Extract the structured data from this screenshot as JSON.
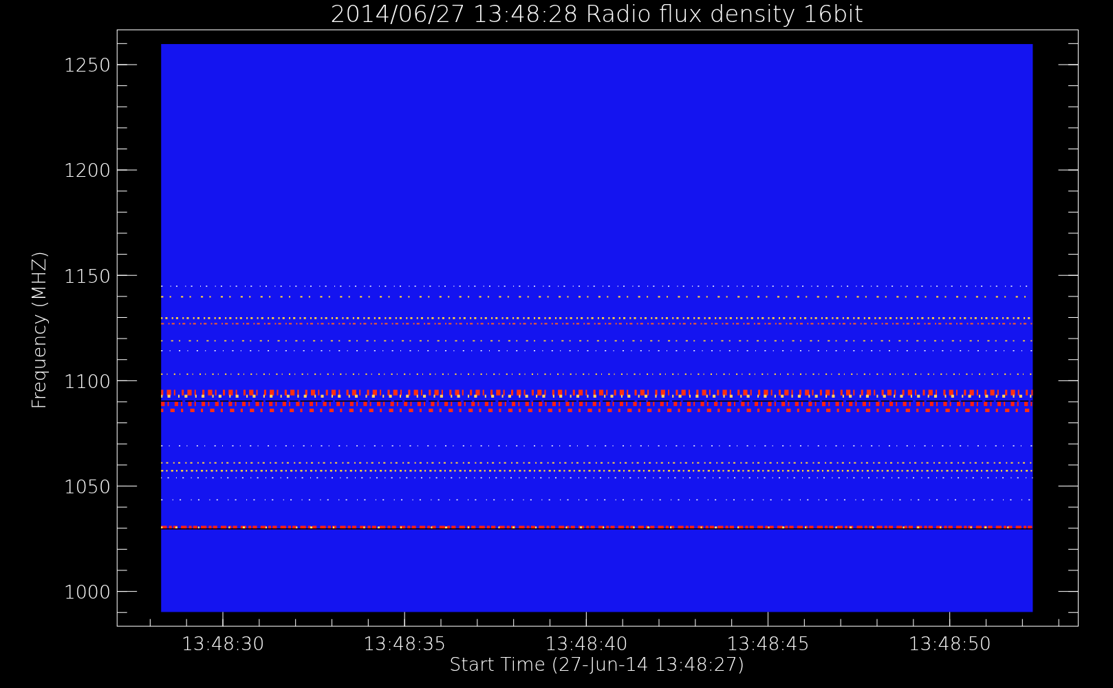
{
  "title": "2014/06/27 13:48:28 Radio flux density 16bit",
  "x_axis": {
    "label": "Start Time (27-Jun-14 13:48:27)",
    "ticks": [
      "13:48:30",
      "13:48:35",
      "13:48:40",
      "13:48:45",
      "13:48:50"
    ]
  },
  "y_axis": {
    "label": "Frequency (MHZ)",
    "ticks": [
      "1250",
      "1200",
      "1150",
      "1100",
      "1050",
      "1000"
    ]
  }
}
